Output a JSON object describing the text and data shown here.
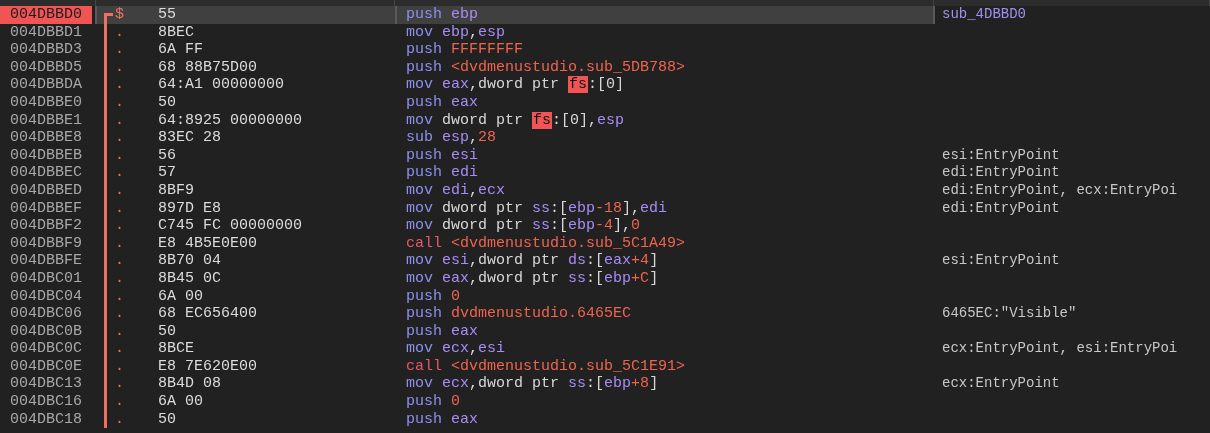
{
  "rows": [
    {
      "address": "004DBBD0",
      "selected": true,
      "marker": "$",
      "bytes": "55",
      "instruction": [
        {
          "text": "push ",
          "kind": "mnemonic"
        },
        {
          "text": "ebp",
          "kind": "register"
        }
      ],
      "comment": {
        "text": "sub_4DBBD0",
        "kind": "label"
      }
    },
    {
      "address": "004DBBD1",
      "selected": false,
      "marker": ".",
      "bytes": "8BEC",
      "instruction": [
        {
          "text": "mov ",
          "kind": "mnemonic"
        },
        {
          "text": "ebp",
          "kind": "register"
        },
        {
          "text": ",",
          "kind": "plain"
        },
        {
          "text": "esp",
          "kind": "register"
        }
      ]
    },
    {
      "address": "004DBBD3",
      "selected": false,
      "marker": ".",
      "bytes": "6A FF",
      "instruction": [
        {
          "text": "push ",
          "kind": "mnemonic"
        },
        {
          "text": "FFFFFFFF",
          "kind": "number"
        }
      ]
    },
    {
      "address": "004DBBD5",
      "selected": false,
      "marker": ".",
      "bytes": "68 88B75D00",
      "instruction": [
        {
          "text": "push ",
          "kind": "mnemonic"
        },
        {
          "text": "<dvdmenustudio.sub_5DB788>",
          "kind": "number"
        }
      ]
    },
    {
      "address": "004DBBDA",
      "selected": false,
      "marker": ".",
      "bytes": "64:A1 00000000",
      "instruction": [
        {
          "text": "mov ",
          "kind": "mnemonic"
        },
        {
          "text": "eax",
          "kind": "register"
        },
        {
          "text": ",dword ptr ",
          "kind": "plain"
        },
        {
          "text": "fs",
          "kind": "segment-alert"
        },
        {
          "text": ":[0]",
          "kind": "plain"
        }
      ]
    },
    {
      "address": "004DBBE0",
      "selected": false,
      "marker": ".",
      "bytes": "50",
      "instruction": [
        {
          "text": "push ",
          "kind": "mnemonic"
        },
        {
          "text": "eax",
          "kind": "register"
        }
      ]
    },
    {
      "address": "004DBBE1",
      "selected": false,
      "marker": ".",
      "bytes": "64:8925 00000000",
      "instruction": [
        {
          "text": "mov ",
          "kind": "mnemonic"
        },
        {
          "text": "dword ptr ",
          "kind": "plain"
        },
        {
          "text": "fs",
          "kind": "segment-alert"
        },
        {
          "text": ":[0],",
          "kind": "plain"
        },
        {
          "text": "esp",
          "kind": "register"
        }
      ]
    },
    {
      "address": "004DBBE8",
      "selected": false,
      "marker": ".",
      "bytes": "83EC 28",
      "instruction": [
        {
          "text": "sub ",
          "kind": "mnemonic"
        },
        {
          "text": "esp",
          "kind": "register"
        },
        {
          "text": ",",
          "kind": "plain"
        },
        {
          "text": "28",
          "kind": "number"
        }
      ]
    },
    {
      "address": "004DBBEB",
      "selected": false,
      "marker": ".",
      "bytes": "56",
      "instruction": [
        {
          "text": "push ",
          "kind": "mnemonic"
        },
        {
          "text": "esi",
          "kind": "register"
        }
      ],
      "comment": {
        "text": "esi:EntryPoint",
        "kind": "auto"
      }
    },
    {
      "address": "004DBBEC",
      "selected": false,
      "marker": ".",
      "bytes": "57",
      "instruction": [
        {
          "text": "push ",
          "kind": "mnemonic"
        },
        {
          "text": "edi",
          "kind": "register"
        }
      ],
      "comment": {
        "text": "edi:EntryPoint",
        "kind": "auto"
      }
    },
    {
      "address": "004DBBED",
      "selected": false,
      "marker": ".",
      "bytes": "8BF9",
      "instruction": [
        {
          "text": "mov ",
          "kind": "mnemonic"
        },
        {
          "text": "edi",
          "kind": "register"
        },
        {
          "text": ",",
          "kind": "plain"
        },
        {
          "text": "ecx",
          "kind": "register"
        }
      ],
      "comment": {
        "text": "edi:EntryPoint, ecx:EntryPoi",
        "kind": "auto"
      }
    },
    {
      "address": "004DBBEF",
      "selected": false,
      "marker": ".",
      "bytes": "897D E8",
      "instruction": [
        {
          "text": "mov ",
          "kind": "mnemonic"
        },
        {
          "text": "dword ptr ",
          "kind": "plain"
        },
        {
          "text": "ss",
          "kind": "segment"
        },
        {
          "text": ":[",
          "kind": "plain"
        },
        {
          "text": "ebp",
          "kind": "register"
        },
        {
          "text": "-18",
          "kind": "number"
        },
        {
          "text": "],",
          "kind": "plain"
        },
        {
          "text": "edi",
          "kind": "register"
        }
      ],
      "comment": {
        "text": "edi:EntryPoint",
        "kind": "auto"
      }
    },
    {
      "address": "004DBBF2",
      "selected": false,
      "marker": ".",
      "bytes": "C745 FC 00000000",
      "instruction": [
        {
          "text": "mov ",
          "kind": "mnemonic"
        },
        {
          "text": "dword ptr ",
          "kind": "plain"
        },
        {
          "text": "ss",
          "kind": "segment"
        },
        {
          "text": ":[",
          "kind": "plain"
        },
        {
          "text": "ebp",
          "kind": "register"
        },
        {
          "text": "-4",
          "kind": "number"
        },
        {
          "text": "],",
          "kind": "plain"
        },
        {
          "text": "0",
          "kind": "number"
        }
      ]
    },
    {
      "address": "004DBBF9",
      "selected": false,
      "marker": ".",
      "bytes": "E8 4B5E0E00",
      "instruction": [
        {
          "text": "call ",
          "kind": "call"
        },
        {
          "text": "<dvdmenustudio.sub_5C1A49>",
          "kind": "number"
        }
      ]
    },
    {
      "address": "004DBBFE",
      "selected": false,
      "marker": ".",
      "bytes": "8B70 04",
      "instruction": [
        {
          "text": "mov ",
          "kind": "mnemonic"
        },
        {
          "text": "esi",
          "kind": "register"
        },
        {
          "text": ",dword ptr ",
          "kind": "plain"
        },
        {
          "text": "ds",
          "kind": "segment"
        },
        {
          "text": ":[",
          "kind": "plain"
        },
        {
          "text": "eax",
          "kind": "register"
        },
        {
          "text": "+4",
          "kind": "number"
        },
        {
          "text": "]",
          "kind": "plain"
        }
      ],
      "comment": {
        "text": "esi:EntryPoint",
        "kind": "auto"
      }
    },
    {
      "address": "004DBC01",
      "selected": false,
      "marker": ".",
      "bytes": "8B45 0C",
      "instruction": [
        {
          "text": "mov ",
          "kind": "mnemonic"
        },
        {
          "text": "eax",
          "kind": "register"
        },
        {
          "text": ",dword ptr ",
          "kind": "plain"
        },
        {
          "text": "ss",
          "kind": "segment"
        },
        {
          "text": ":[",
          "kind": "plain"
        },
        {
          "text": "ebp",
          "kind": "register"
        },
        {
          "text": "+C",
          "kind": "number"
        },
        {
          "text": "]",
          "kind": "plain"
        }
      ]
    },
    {
      "address": "004DBC04",
      "selected": false,
      "marker": ".",
      "bytes": "6A 00",
      "instruction": [
        {
          "text": "push ",
          "kind": "mnemonic"
        },
        {
          "text": "0",
          "kind": "number"
        }
      ]
    },
    {
      "address": "004DBC06",
      "selected": false,
      "marker": ".",
      "bytes": "68 EC656400",
      "instruction": [
        {
          "text": "push ",
          "kind": "mnemonic"
        },
        {
          "text": "dvdmenustudio.6465EC",
          "kind": "number"
        }
      ],
      "comment": {
        "text": "6465EC:\"Visible\"",
        "kind": "auto"
      }
    },
    {
      "address": "004DBC0B",
      "selected": false,
      "marker": ".",
      "bytes": "50",
      "instruction": [
        {
          "text": "push ",
          "kind": "mnemonic"
        },
        {
          "text": "eax",
          "kind": "register"
        }
      ]
    },
    {
      "address": "004DBC0C",
      "selected": false,
      "marker": ".",
      "bytes": "8BCE",
      "instruction": [
        {
          "text": "mov ",
          "kind": "mnemonic"
        },
        {
          "text": "ecx",
          "kind": "register"
        },
        {
          "text": ",",
          "kind": "plain"
        },
        {
          "text": "esi",
          "kind": "register"
        }
      ],
      "comment": {
        "text": "ecx:EntryPoint, esi:EntryPoi",
        "kind": "auto"
      }
    },
    {
      "address": "004DBC0E",
      "selected": false,
      "marker": ".",
      "bytes": "E8 7E620E00",
      "instruction": [
        {
          "text": "call ",
          "kind": "call"
        },
        {
          "text": "<dvdmenustudio.sub_5C1E91>",
          "kind": "number"
        }
      ]
    },
    {
      "address": "004DBC13",
      "selected": false,
      "marker": ".",
      "bytes": "8B4D 08",
      "instruction": [
        {
          "text": "mov ",
          "kind": "mnemonic"
        },
        {
          "text": "ecx",
          "kind": "register"
        },
        {
          "text": ",dword ptr ",
          "kind": "plain"
        },
        {
          "text": "ss",
          "kind": "segment"
        },
        {
          "text": ":[",
          "kind": "plain"
        },
        {
          "text": "ebp",
          "kind": "register"
        },
        {
          "text": "+8",
          "kind": "number"
        },
        {
          "text": "]",
          "kind": "plain"
        }
      ],
      "comment": {
        "text": "ecx:EntryPoint",
        "kind": "auto"
      }
    },
    {
      "address": "004DBC16",
      "selected": false,
      "marker": ".",
      "bytes": "6A 00",
      "instruction": [
        {
          "text": "push ",
          "kind": "mnemonic"
        },
        {
          "text": "0",
          "kind": "number"
        }
      ]
    },
    {
      "address": "004DBC18",
      "selected": false,
      "marker": ".",
      "bytes": "50",
      "instruction": [
        {
          "text": "push ",
          "kind": "mnemonic"
        },
        {
          "text": "eax",
          "kind": "register"
        }
      ]
    }
  ]
}
